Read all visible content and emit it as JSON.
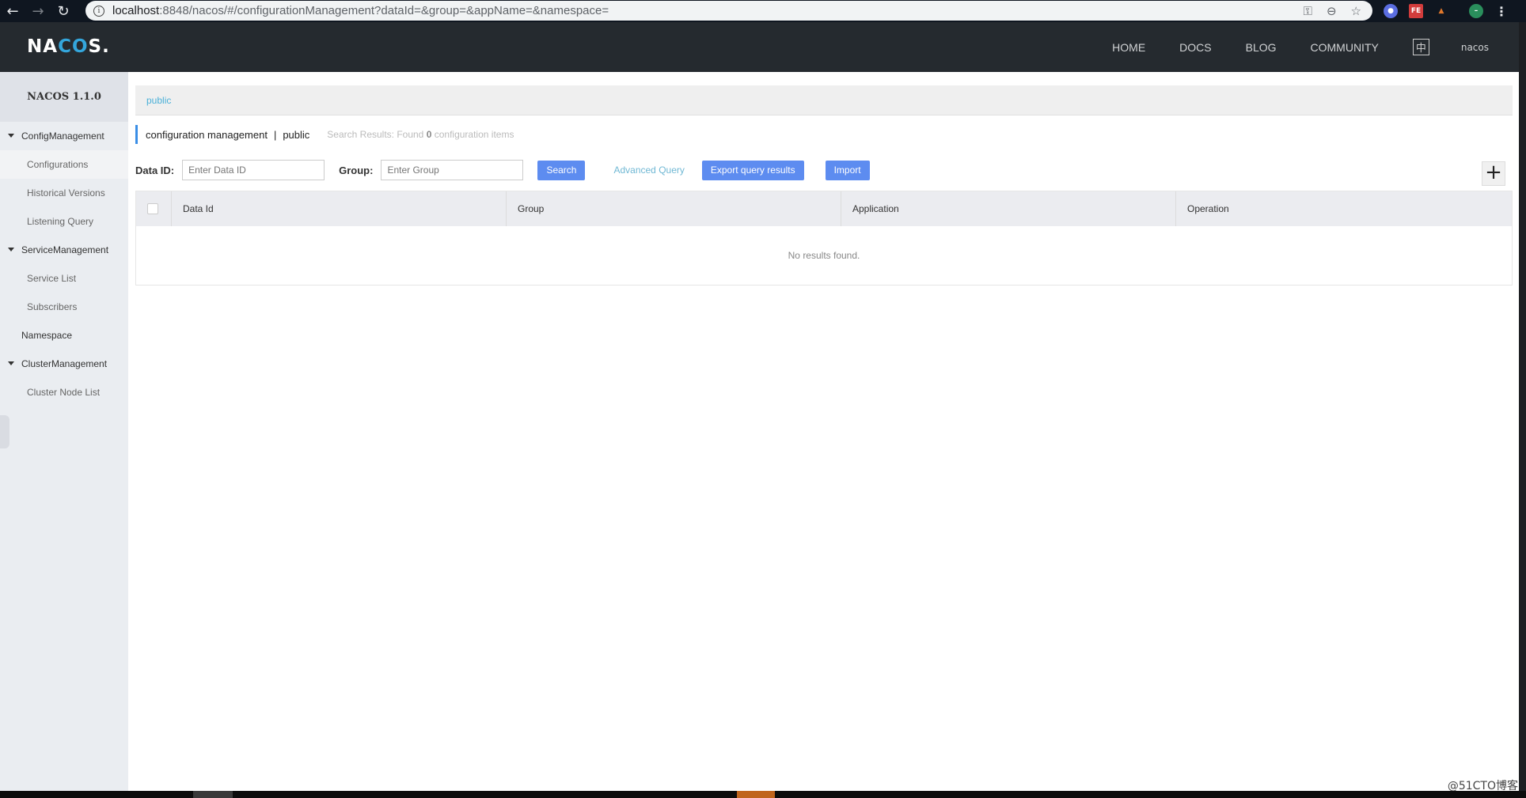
{
  "browser": {
    "url_host": "localhost",
    "url_rest": ":8848/nacos/#/configurationManagement?dataId=&group=&appName=&namespace=",
    "extensions": [
      {
        "name": "extension-blue",
        "glyph": "●",
        "color": "#5b6ee1"
      },
      {
        "name": "extension-fe",
        "glyph": "FE",
        "color": "#d23c3c"
      },
      {
        "name": "extension-fox",
        "glyph": "▲",
        "color": "#e0782b"
      },
      {
        "name": "profile",
        "glyph": "–",
        "color": "#2a8f5c"
      }
    ]
  },
  "header": {
    "logo_left": "NA",
    "logo_mid": "CO",
    "logo_right": "S.",
    "nav": [
      "HOME",
      "DOCS",
      "BLOG",
      "COMMUNITY"
    ],
    "lang_toggle": "中",
    "user": "nacos"
  },
  "sidebar": {
    "title": "NACOS 1.1.0",
    "items": [
      {
        "label": "ConfigManagement",
        "type": "group"
      },
      {
        "label": "Configurations",
        "type": "sub",
        "active": true
      },
      {
        "label": "Historical Versions",
        "type": "sub"
      },
      {
        "label": "Listening Query",
        "type": "sub"
      },
      {
        "label": "ServiceManagement",
        "type": "group"
      },
      {
        "label": "Service List",
        "type": "sub"
      },
      {
        "label": "Subscribers",
        "type": "sub"
      },
      {
        "label": "Namespace",
        "type": "top"
      },
      {
        "label": "ClusterManagement",
        "type": "group"
      },
      {
        "label": "Cluster Node List",
        "type": "sub"
      }
    ]
  },
  "main": {
    "namespace_tab": "public",
    "title": "configuration management",
    "title_sep": "|",
    "title_namespace": "public",
    "result_prefix": "Search Results: Found ",
    "result_count": "0",
    "result_suffix": " configuration items",
    "filters": {
      "data_id_label": "Data ID:",
      "data_id_placeholder": "Enter Data ID",
      "data_id_value": "",
      "group_label": "Group:",
      "group_placeholder": "Enter Group",
      "group_value": ""
    },
    "buttons": {
      "search": "Search",
      "advanced": "Advanced Query",
      "export": "Export query results",
      "import": "Import",
      "add": "+"
    },
    "table": {
      "columns": [
        "Data Id",
        "Group",
        "Application",
        "Operation"
      ],
      "rows": [],
      "empty_text": "No results found."
    }
  },
  "watermark": "@51CTO博客"
}
